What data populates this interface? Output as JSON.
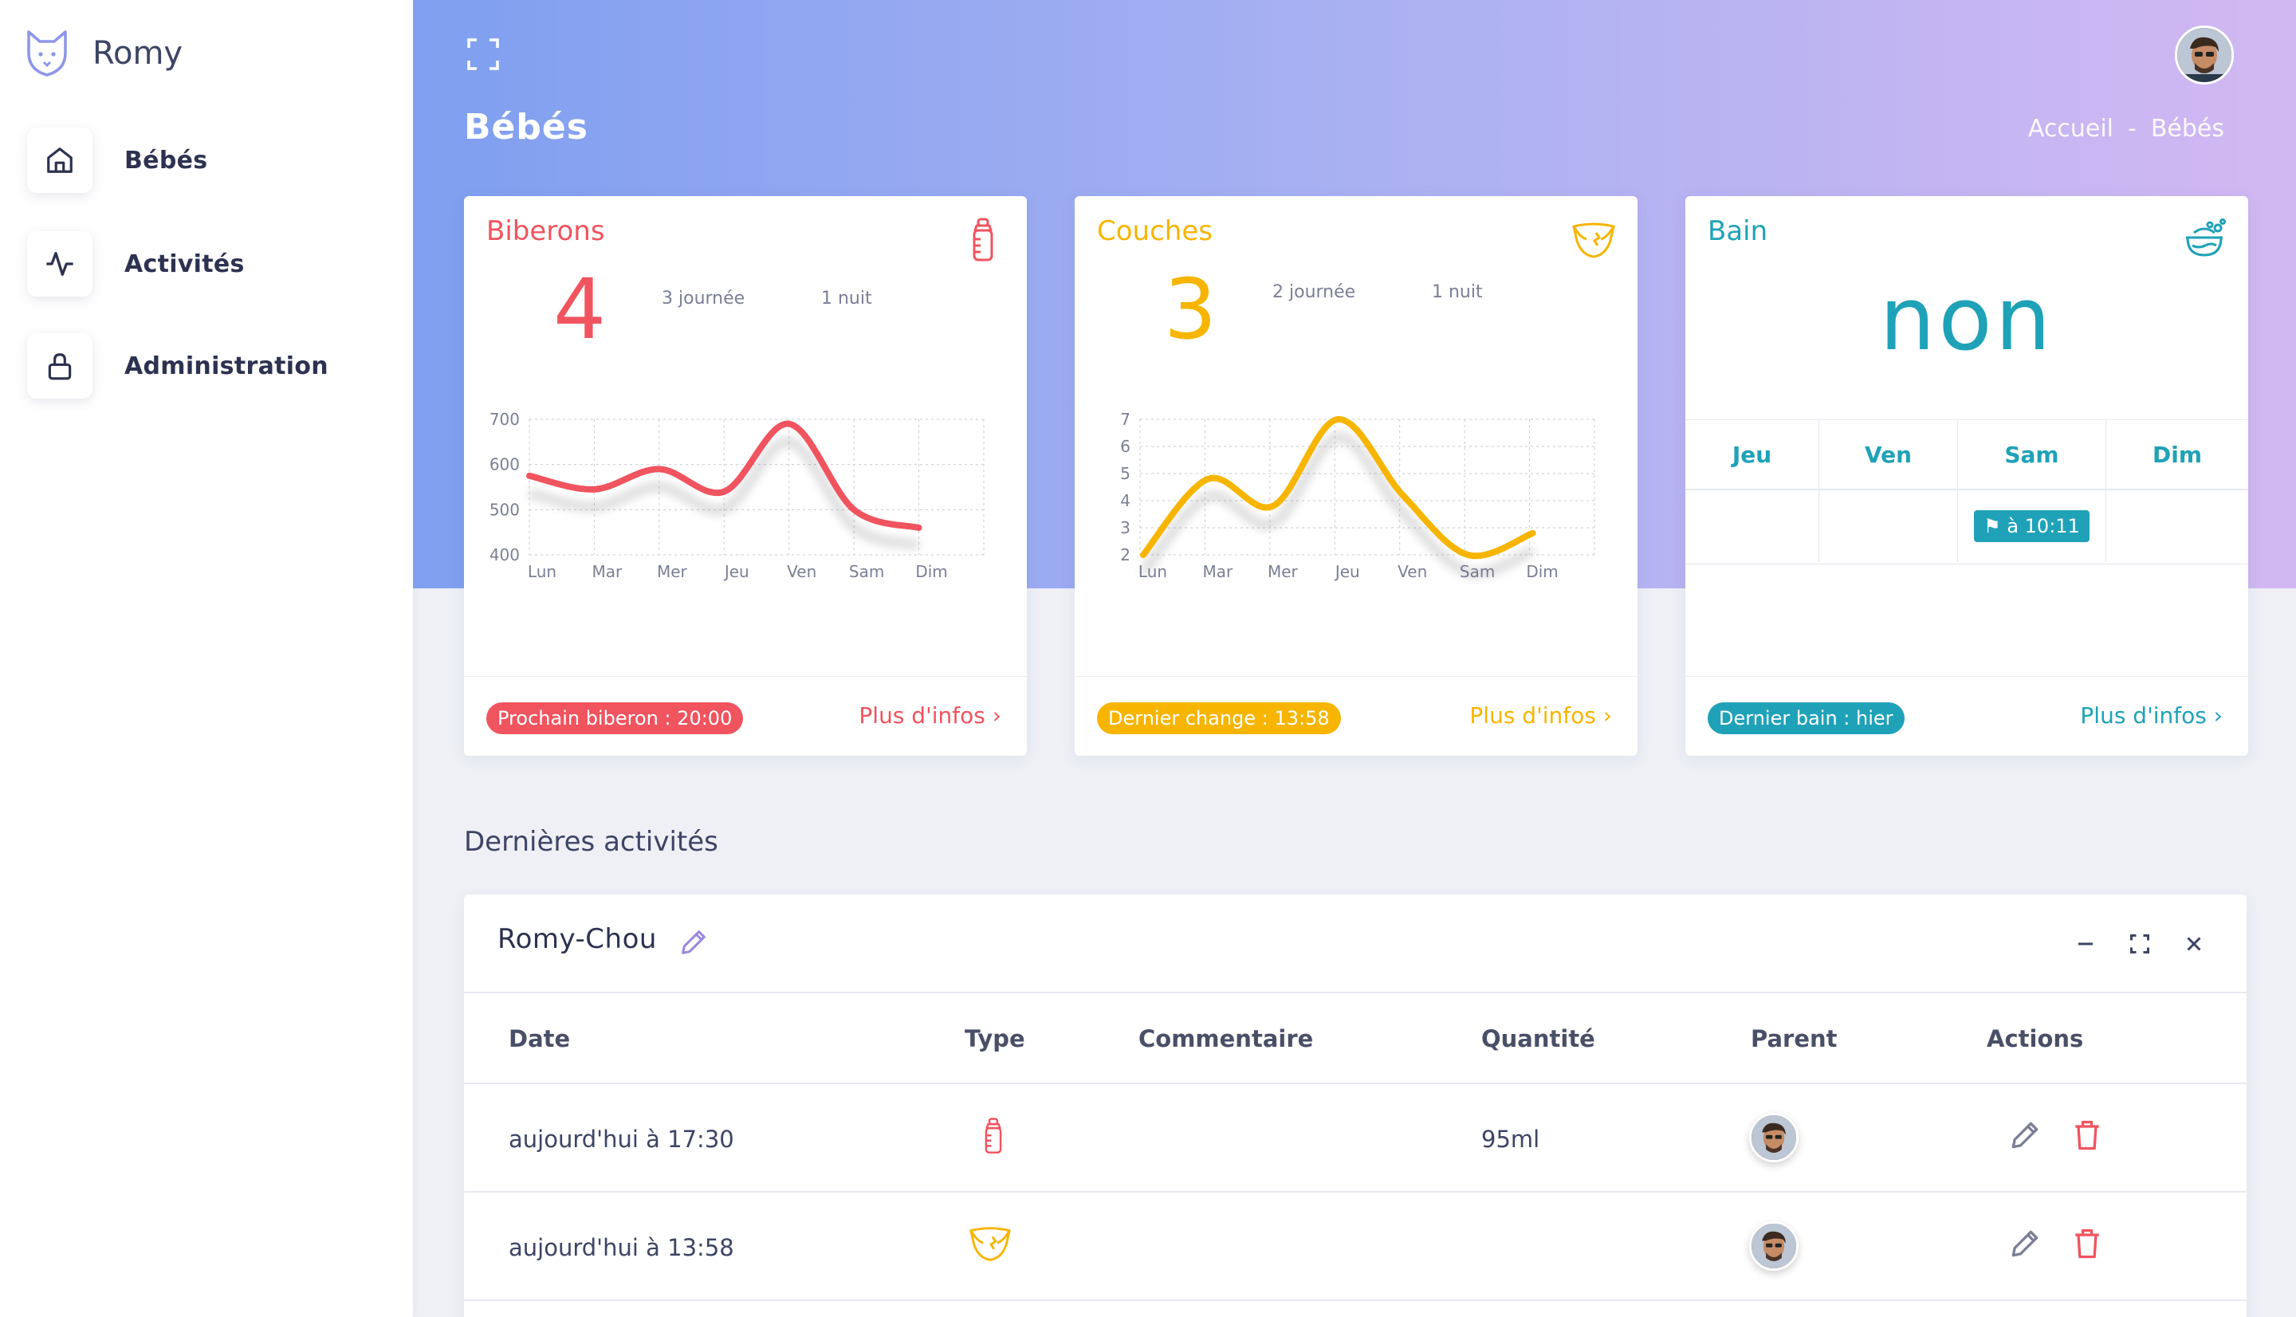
{
  "app": {
    "name": "Romy"
  },
  "sidebar": {
    "items": [
      {
        "label": "Bébés",
        "icon": "home-icon"
      },
      {
        "label": "Activités",
        "icon": "activity-icon"
      },
      {
        "label": "Administration",
        "icon": "lock-icon"
      }
    ]
  },
  "header": {
    "title": "Bébés",
    "breadcrumb": [
      "Accueil",
      "-",
      "Bébés"
    ]
  },
  "cards": {
    "biberons": {
      "title": "Biberons",
      "count": "4",
      "day": "3 journée",
      "night": "1 nuit",
      "badge": "Prochain biberon : 20:00",
      "more": "Plus d'infos",
      "color": "#f0545f"
    },
    "couches": {
      "title": "Couches",
      "count": "3",
      "day": "2 journée",
      "night": "1 nuit",
      "badge": "Dernier change : 13:58",
      "more": "Plus d'infos",
      "color": "#f7b500"
    },
    "bain": {
      "title": "Bain",
      "value": "non",
      "days": [
        "Jeu",
        "Ven",
        "Sam",
        "Dim"
      ],
      "chip": "à 10:11",
      "badge": "Dernier bain : hier",
      "more": "Plus d'infos",
      "color": "#1fa2b8"
    }
  },
  "chart_data": [
    {
      "type": "line",
      "categories": [
        "Lun",
        "Mar",
        "Mer",
        "Jeu",
        "Ven",
        "Sam",
        "Dim"
      ],
      "yticks": [
        "700",
        "600",
        "500",
        "400"
      ],
      "ylim": [
        400,
        700
      ],
      "series": [
        {
          "values": [
            575,
            545,
            590,
            540,
            690,
            500,
            460
          ]
        }
      ],
      "color": "#f0545f"
    },
    {
      "type": "line",
      "categories": [
        "Lun",
        "Mar",
        "Mer",
        "Jeu",
        "Ven",
        "Sam",
        "Dim"
      ],
      "yticks": [
        "7",
        "6",
        "5",
        "4",
        "3",
        "2"
      ],
      "ylim": [
        2,
        7
      ],
      "series": [
        {
          "values": [
            2,
            4.8,
            3.8,
            7,
            4.2,
            2,
            2.8
          ]
        }
      ],
      "color": "#f7b500"
    }
  ],
  "activities": {
    "section_title": "Dernières activités",
    "panel_title": "Romy-Chou",
    "columns": [
      "Date",
      "Type",
      "Commentaire",
      "Quantité",
      "Parent",
      "Actions"
    ],
    "rows": [
      {
        "date": "aujourd'hui à 17:30",
        "type": "bottle-icon",
        "comment": "",
        "quantity": "95ml"
      },
      {
        "date": "aujourd'hui à 13:58",
        "type": "diaper-icon",
        "comment": "",
        "quantity": ""
      }
    ]
  }
}
